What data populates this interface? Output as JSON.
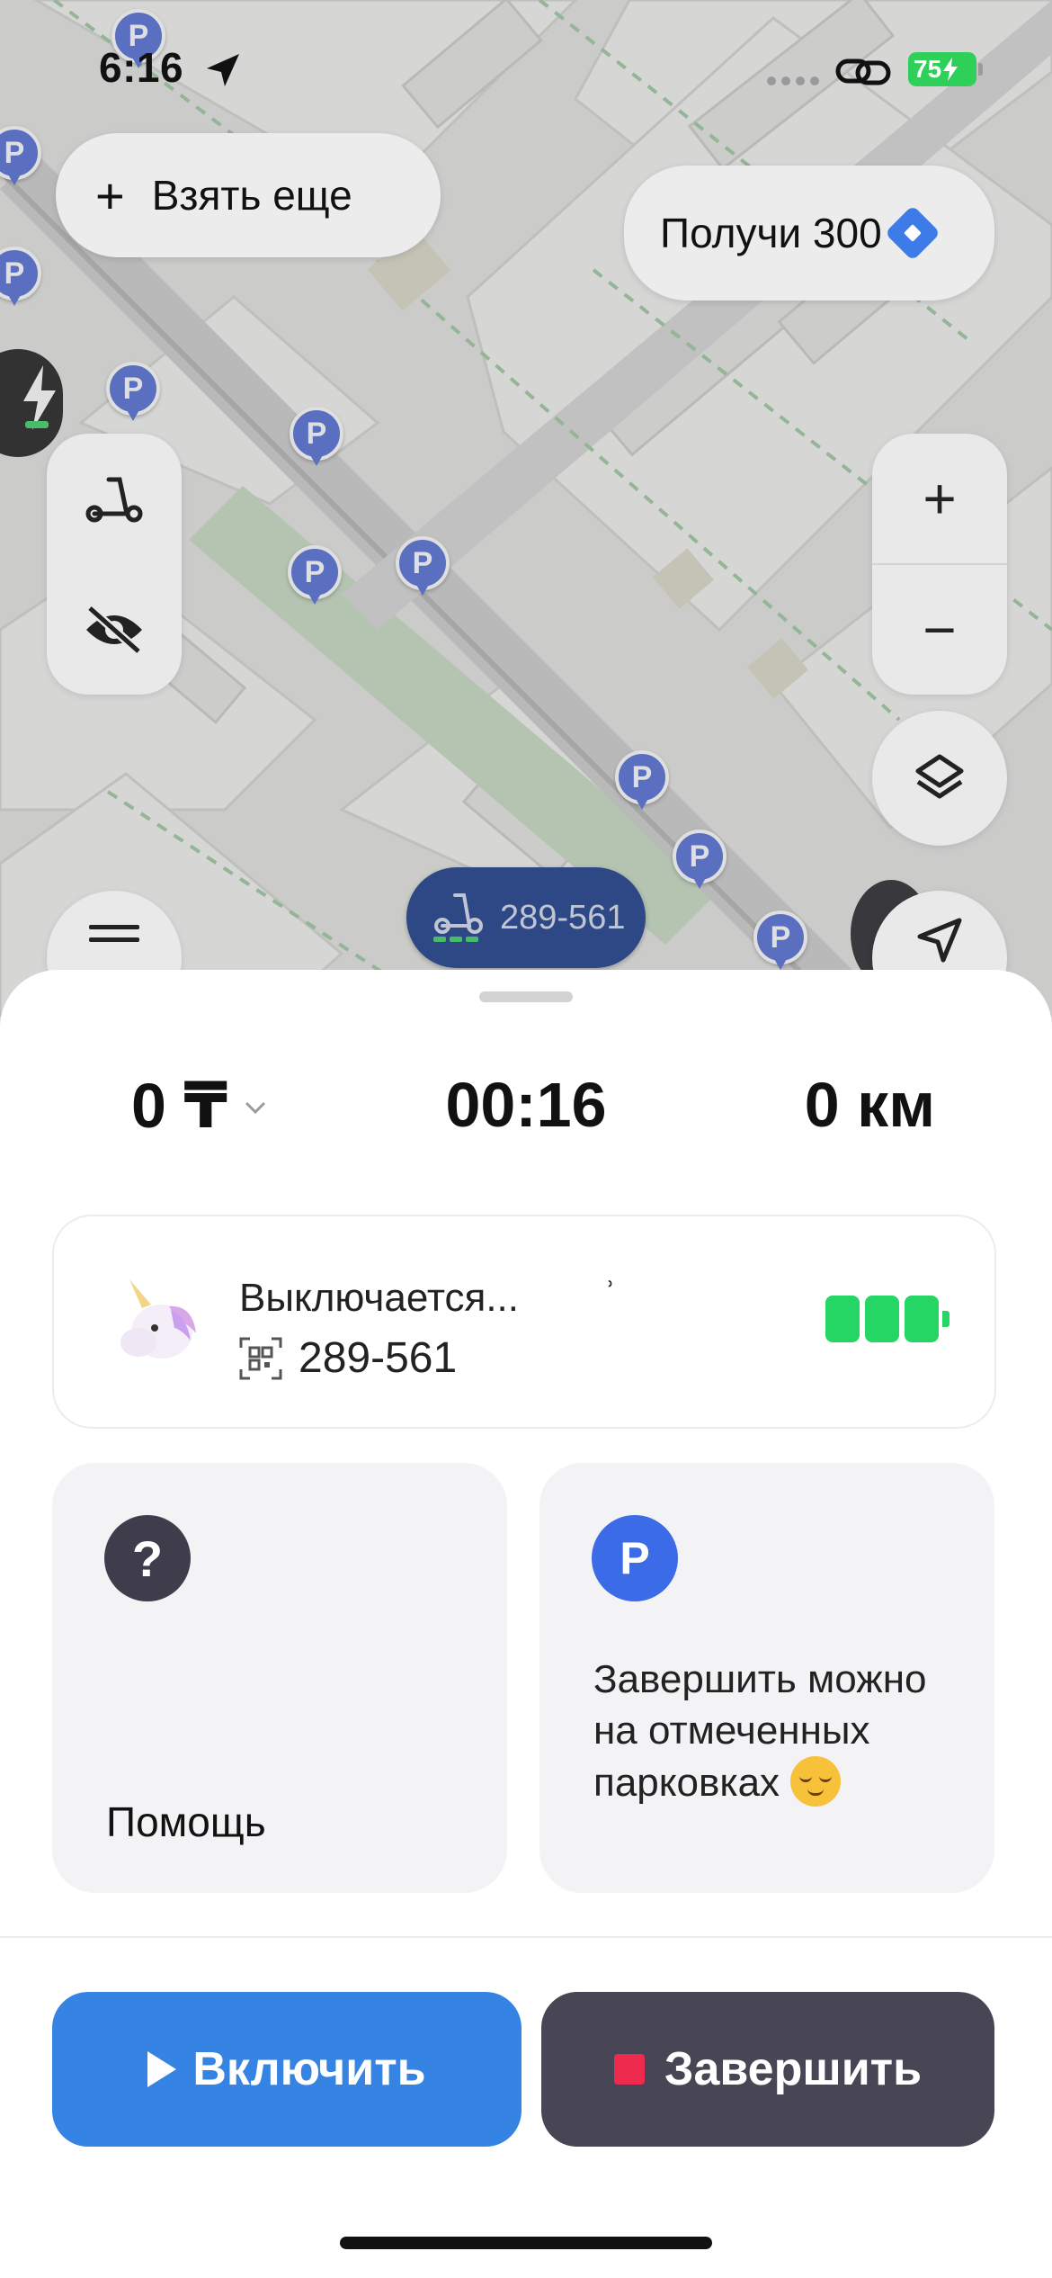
{
  "status_bar": {
    "time": "6:16",
    "battery_level": "75",
    "icons": [
      "location-arrow-icon",
      "dots-icon",
      "link-icon",
      "battery-charging-icon"
    ]
  },
  "map": {
    "take_more_label": "Взять еще",
    "get_bonus_label": "Получи 300",
    "parking_pin_label": "P",
    "scooter_marker_number": "289-561",
    "controls": {
      "zoom_in": "+",
      "zoom_out": "−"
    },
    "colors": {
      "parking_pin": "#5570d6",
      "scooter_marker": "#1b3e8c",
      "park": "#b8d8b2"
    }
  },
  "ride": {
    "cost": "0 ₸",
    "duration": "00:16",
    "distance": "0 км"
  },
  "scooter": {
    "status": "Выключается...",
    "tick": "ʾ",
    "number": "289-561",
    "battery_cells": 3,
    "battery_color": "#26d665"
  },
  "tiles": {
    "help": {
      "icon": "?",
      "label": "Помощь"
    },
    "parking": {
      "icon": "P",
      "label": "Завершить можно на отмеченных парковках"
    }
  },
  "actions": {
    "start_label": "Включить",
    "finish_label": "Завершить",
    "start_color": "#3583e3",
    "finish_color": "#484655",
    "stop_color": "#ef2a4f"
  }
}
